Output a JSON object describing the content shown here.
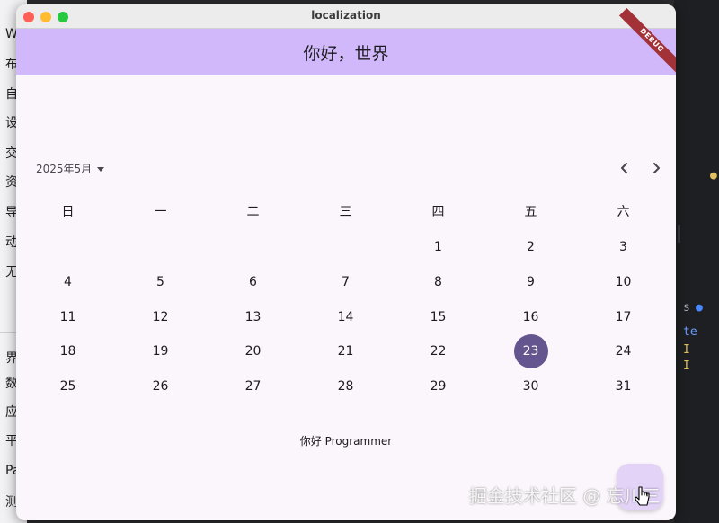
{
  "window": {
    "title": "localization"
  },
  "appbar": {
    "title": "你好，世界",
    "debug_banner": "DEBUG"
  },
  "calendar": {
    "month_label": "2025年5月",
    "weekdays": [
      "日",
      "一",
      "二",
      "三",
      "四",
      "五",
      "六"
    ],
    "weeks": [
      [
        "",
        "",
        "",
        "",
        "1",
        "2",
        "3"
      ],
      [
        "4",
        "5",
        "6",
        "7",
        "8",
        "9",
        "10"
      ],
      [
        "11",
        "12",
        "13",
        "14",
        "15",
        "16",
        "17"
      ],
      [
        "18",
        "19",
        "20",
        "21",
        "22",
        "23",
        "24"
      ],
      [
        "25",
        "26",
        "27",
        "28",
        "29",
        "30",
        "31"
      ]
    ],
    "selected_day": "23"
  },
  "greeting": "你好 Programmer",
  "watermark": "掘金技术社区 @ 忘川三",
  "background_left": [
    "W",
    "布",
    "自",
    "设",
    "交",
    "资",
    "导",
    "动",
    "无",
    "界",
    "数",
    "应",
    "平",
    "Pa",
    "测"
  ],
  "colors": {
    "appbar": "#d0b8fb",
    "selected": "#65558f",
    "surface": "#fbf6fb",
    "fab": "#e3d4f7",
    "debug": "#a33238"
  }
}
